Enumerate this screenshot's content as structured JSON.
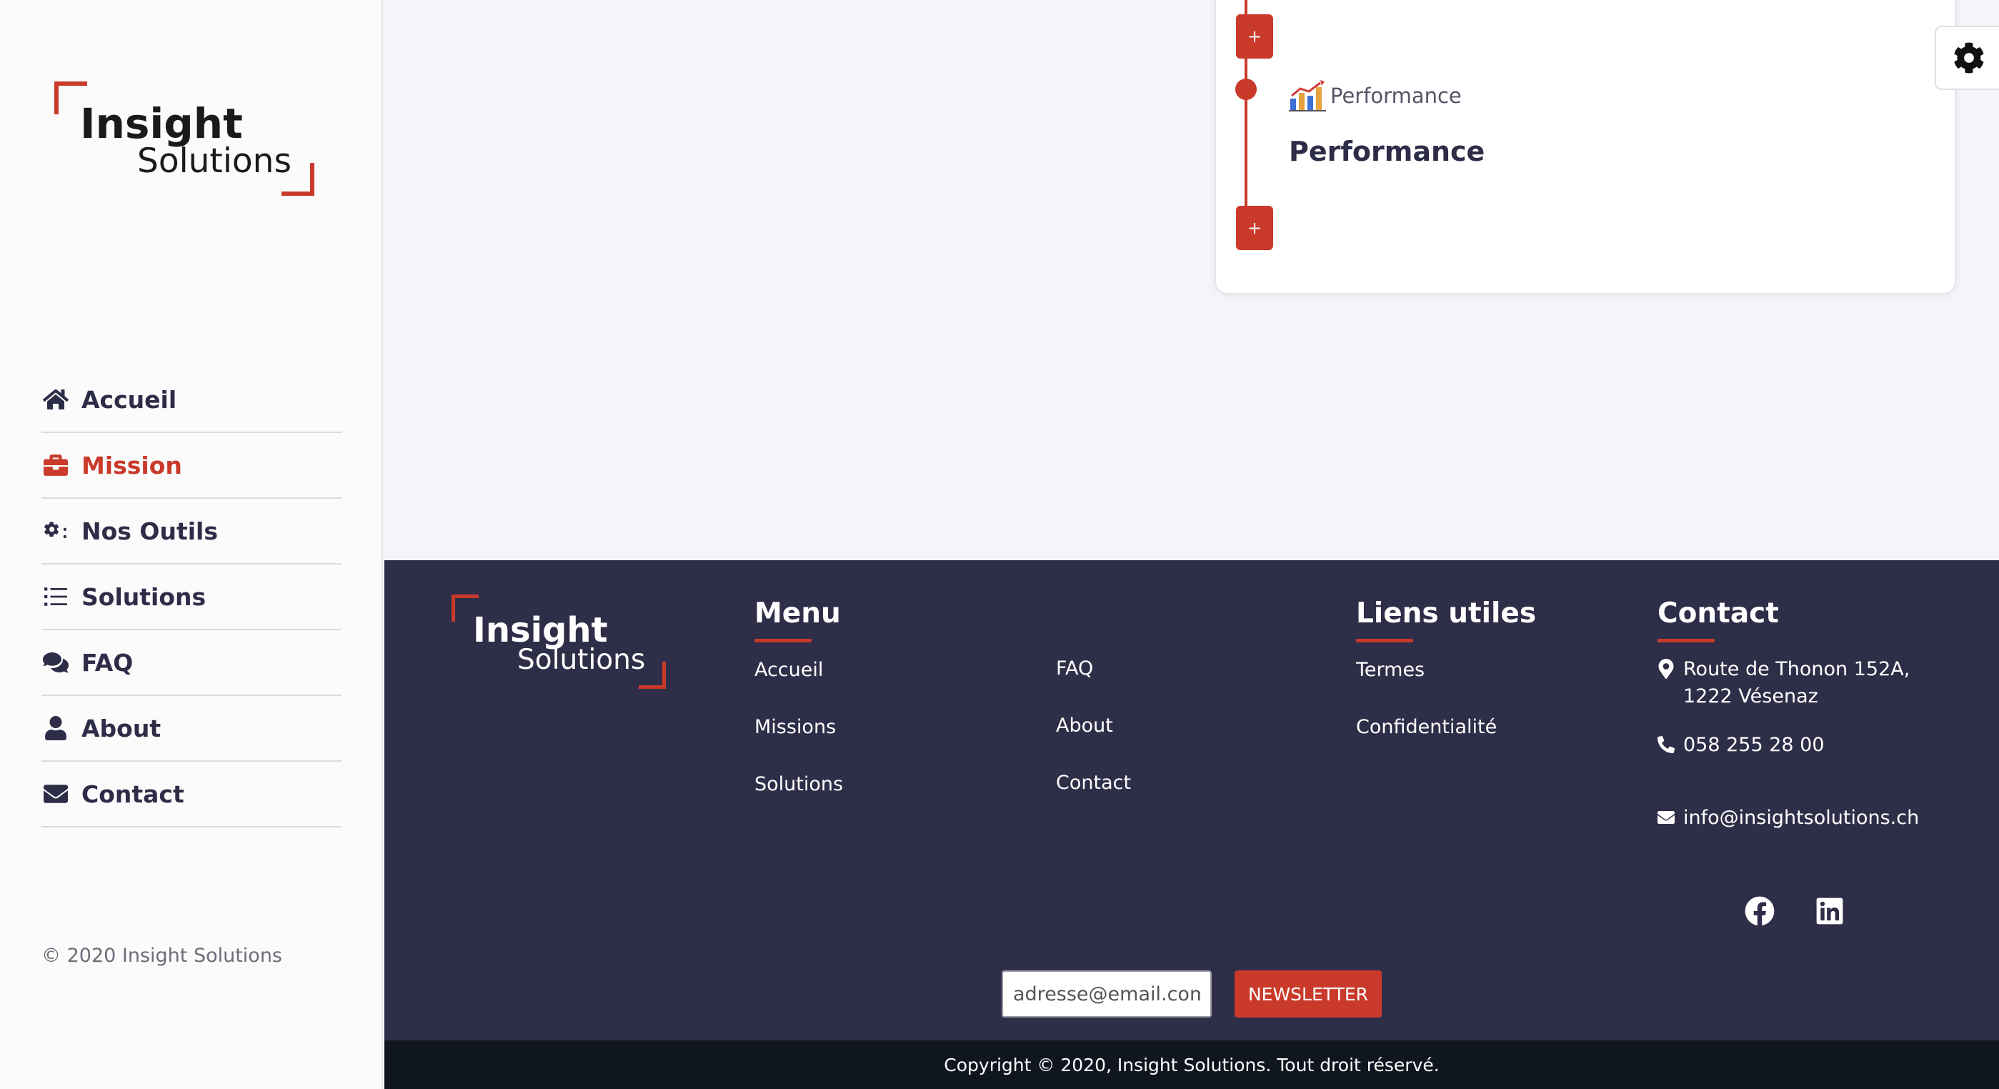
{
  "brand": {
    "line1": "Insight",
    "line2": "Solutions",
    "accent_color": "#c93a2b",
    "dark_color": "#2f2e48"
  },
  "sidebar": {
    "items": [
      {
        "label": "Accueil",
        "icon": "home-icon",
        "active": false
      },
      {
        "label": "Mission",
        "icon": "briefcase-icon",
        "active": true
      },
      {
        "label": "Nos Outils",
        "icon": "cogs-icon",
        "active": false
      },
      {
        "label": "Solutions",
        "icon": "list-icon",
        "active": false
      },
      {
        "label": "FAQ",
        "icon": "comments-icon",
        "active": false
      },
      {
        "label": "About",
        "icon": "user-icon",
        "active": false
      },
      {
        "label": "Contact",
        "icon": "envelope-icon",
        "active": false
      }
    ],
    "copyright": "© 2020 Insight Solutions"
  },
  "timeline": {
    "add_label": "+",
    "tag": "Performance",
    "tag_icon": "bar-chart-icon",
    "title": "Performance"
  },
  "settings": {
    "icon": "gear-icon"
  },
  "footer": {
    "menu_heading": "Menu",
    "menu_col1": [
      "Accueil",
      "Missions",
      "Solutions"
    ],
    "menu_col2": [
      "FAQ",
      "About",
      "Contact"
    ],
    "links_heading": "Liens utiles",
    "links": [
      "Termes",
      "Confidentialité"
    ],
    "contact_heading": "Contact",
    "address_line1": "Route de Thonon 152A,",
    "address_line2": "1222 Vésenaz",
    "phone": "058 255 28 00",
    "email": "info@insightsolutions.ch",
    "social": [
      "facebook-icon",
      "linkedin-icon"
    ],
    "newsletter_placeholder": "adresse@email.com",
    "newsletter_button": "NEWSLETTER",
    "copyright": "Copyright © 2020, Insight Solutions. Tout droit réservé."
  }
}
